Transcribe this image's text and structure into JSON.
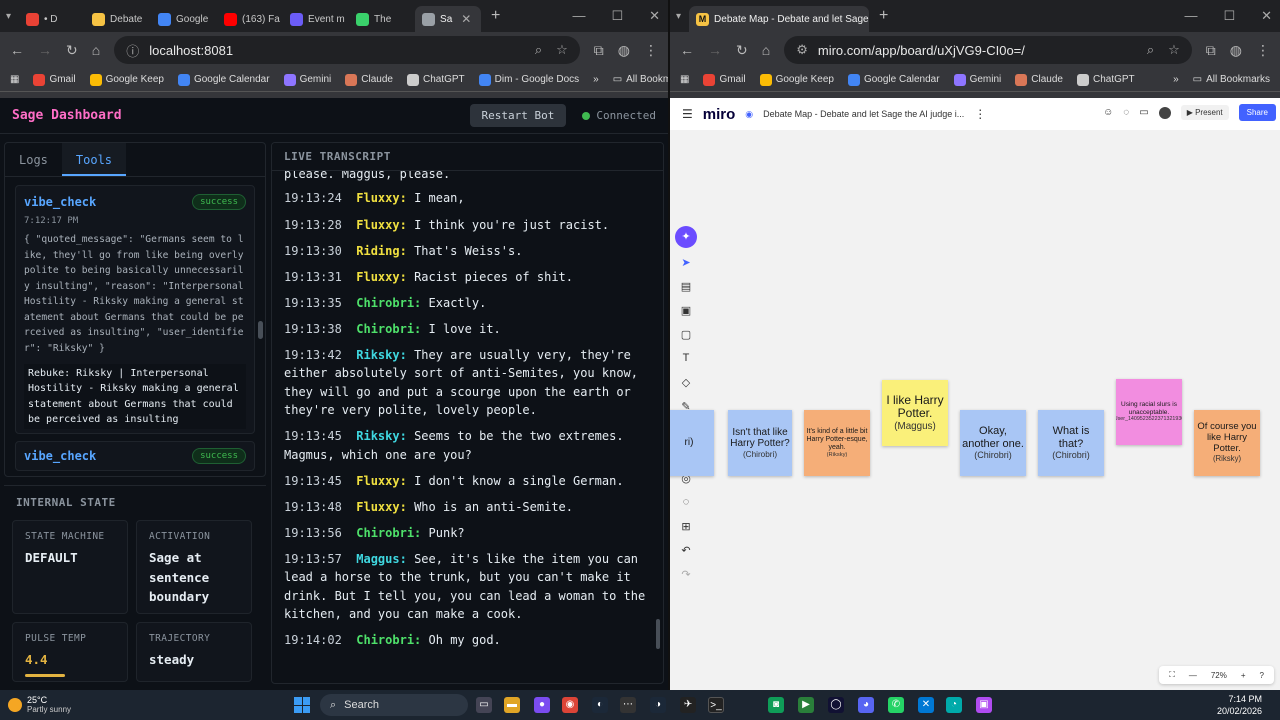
{
  "left_browser": {
    "tabs": [
      {
        "label": "• D",
        "color": "#e94235"
      },
      {
        "label": "Debate",
        "color": "#f6c344"
      },
      {
        "label": "Google",
        "color": "#4285f4"
      },
      {
        "label": "(163) Fa",
        "color": "#ff0000"
      },
      {
        "label": "Event m",
        "color": "#6b5cf6"
      },
      {
        "label": "The",
        "color": "#3ad16b"
      },
      {
        "label": "Sa",
        "color": "#9aa0a6"
      }
    ],
    "url": "localhost:8081",
    "bookmarks": [
      "Gmail",
      "Google Keep",
      "Google Calendar",
      "Gemini",
      "Claude",
      "ChatGPT",
      "Dim - Google Docs"
    ],
    "all_bookmarks": "All Bookmarks"
  },
  "dashboard": {
    "title": "Sage Dashboard",
    "restart": "Restart Bot",
    "status": "Connected",
    "tabs": [
      "Logs",
      "Tools"
    ],
    "card": {
      "name": "vibe_check",
      "badge": "success",
      "time": "7:12:17 PM",
      "json": "{ \"quoted_message\": \"Germans seem to like, they'll go from like being overly polite to being basically unnecessarily insulting\", \"reason\": \"Interpersonal Hostility - Riksky making a general statement about Germans that could be perceived as insulting\", \"user_identifier\": \"Riksky\" }",
      "rebuke": "Rebuke: Riksky | Interpersonal Hostility - Riksky making a general statement about Germans that could be perceived as insulting"
    },
    "card2": {
      "name": "vibe_check",
      "badge": "success"
    },
    "internal_state": {
      "title": "INTERNAL STATE",
      "state_machine_label": "STATE MACHINE",
      "state_machine_value": "DEFAULT",
      "activation_label": "ACTIVATION",
      "activation_value": "Sage at sentence boundary",
      "pulse_label": "PULSE TEMP",
      "pulse_value": "4.4",
      "trajectory_label": "TRAJECTORY",
      "trajectory_value": "steady"
    },
    "transcript": {
      "title": "LIVE TRANSCRIPT",
      "top_fragment": "please. Maggus, please.",
      "lines": [
        {
          "time": "19:13:24",
          "speaker": "Fluxxy:",
          "color": "#f0e040",
          "text": "I mean,"
        },
        {
          "time": "19:13:28",
          "speaker": "Fluxxy:",
          "color": "#f0e040",
          "text": "I think you're just racist."
        },
        {
          "time": "19:13:30",
          "speaker": "Riding:",
          "color": "#f0e040",
          "text": "That's Weiss's."
        },
        {
          "time": "19:13:31",
          "speaker": "Fluxxy:",
          "color": "#f0e040",
          "text": "Racist pieces of shit."
        },
        {
          "time": "19:13:35",
          "speaker": "Chirobri:",
          "color": "#4ee06a",
          "text": "Exactly."
        },
        {
          "time": "19:13:38",
          "speaker": "Chirobri:",
          "color": "#4ee06a",
          "text": "I love it."
        },
        {
          "time": "19:13:42",
          "speaker": "Riksky:",
          "color": "#3fd7e0",
          "text": "They are usually very, they're either absolutely sort of anti-Semites, you know, they will go and put a scourge upon the earth or they're very polite, lovely people."
        },
        {
          "time": "19:13:45",
          "speaker": "Riksky:",
          "color": "#3fd7e0",
          "text": "Seems to be the two extremes. Magmus, which one are you?"
        },
        {
          "time": "19:13:45",
          "speaker": "Fluxxy:",
          "color": "#f0e040",
          "text": "I don't know a single German."
        },
        {
          "time": "19:13:48",
          "speaker": "Fluxxy:",
          "color": "#f0e040",
          "text": "Who is an anti-Semite."
        },
        {
          "time": "19:13:56",
          "speaker": "Chirobri:",
          "color": "#4ee06a",
          "text": "Punk?"
        },
        {
          "time": "19:13:57",
          "speaker": "Maggus:",
          "color": "#3fd7e0",
          "text": "See, it's like the item you can lead a horse to the trunk, but you can't make it drink. But I tell you, you can lead a woman to the kitchen, and you can make a cook."
        },
        {
          "time": "19:14:02",
          "speaker": "Chirobri:",
          "color": "#4ee06a",
          "text": "Oh my god."
        }
      ]
    }
  },
  "right_browser": {
    "tab_label": "Debate Map - Debate and let Sage th",
    "url": "miro.com/app/board/uXjVG9-CI0o=/",
    "bookmarks": [
      "Gmail",
      "Google Keep",
      "Google Calendar",
      "Gemini",
      "Claude",
      "ChatGPT"
    ],
    "all_bookmarks": "All Bookmarks"
  },
  "miro": {
    "logo": "miro",
    "board_title": "Debate Map - Debate and let Sage the AI judge i...",
    "present": "Present",
    "share": "Share",
    "zoom": "72%",
    "stickies": [
      {
        "text": "ri)",
        "name": "",
        "color": "#a9c6f5"
      },
      {
        "text": "Isn't that like Harry Potter?",
        "name": "(Chirobri)",
        "color": "#a9c6f5"
      },
      {
        "text": "It's kind of a little bit Harry Potter-esque, yeah.",
        "name": "(Riksky)",
        "color": "#f5ae78"
      },
      {
        "text": "I like Harry Potter.",
        "name": "(Maggus)",
        "color": "#faf07a"
      },
      {
        "text": "Okay, another one.",
        "name": "(Chirobri)",
        "color": "#a9c6f5"
      },
      {
        "text": "What is that?",
        "name": "(Chirobri)",
        "color": "#a9c6f5"
      },
      {
        "text": "Using racial slurs is unacceptable.",
        "name": "(User_1409523522371321930)",
        "color": "#f28de0"
      },
      {
        "text": "Of course you like Harry Potter.",
        "name": "(Riksky)",
        "color": "#f5ae78"
      }
    ]
  },
  "taskbar": {
    "temp": "25°C",
    "weather": "Partly sunny",
    "search": "Search",
    "time": "7:14 PM",
    "date": "20/02/2026"
  }
}
